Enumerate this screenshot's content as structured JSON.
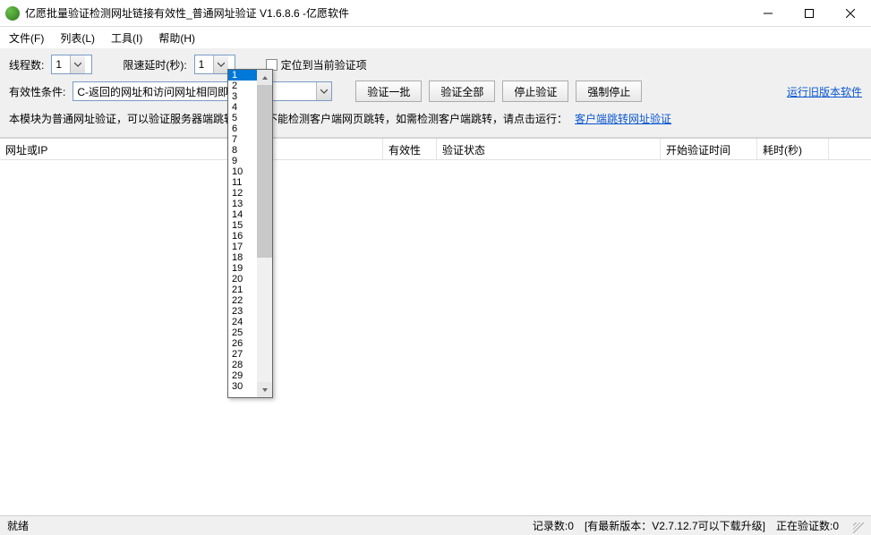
{
  "title": "亿愿批量验证检测网址链接有效性_普通网址验证 V1.6.8.6 -亿愿软件",
  "menu": {
    "file": "文件(F)",
    "list": "列表(L)",
    "tool": "工具(I)",
    "help": "帮助(H)"
  },
  "toolbar": {
    "threads_label": "线程数:",
    "threads_value": "1",
    "delay_label": "限速延时(秒):",
    "delay_value": "1",
    "locate_label": "定位到当前验证项",
    "condition_label": "有效性条件:",
    "condition_value": "C-返回的网址和访问网址相同即为有效",
    "btn_verify_one": "验证一批",
    "btn_verify_all": "验证全部",
    "btn_stop": "停止验证",
    "btn_force_stop": "强制停止",
    "link_old_version": "运行旧版本软件",
    "info_prefix": "本模块为普通网址验证，可以验证服务器端跳转，但是不能检测客户端网页跳转，如需检测客户端跳转，请点击运行：",
    "link_client_redirect": "客户端跳转网址验证"
  },
  "columns": {
    "url": "网址或IP",
    "valid": "有效性",
    "status": "验证状态",
    "start": "开始验证时间",
    "duration": "耗时(秒)"
  },
  "dropdown_items": [
    "1",
    "2",
    "3",
    "4",
    "5",
    "6",
    "7",
    "8",
    "9",
    "10",
    "11",
    "12",
    "13",
    "14",
    "15",
    "16",
    "17",
    "18",
    "19",
    "20",
    "21",
    "22",
    "23",
    "24",
    "25",
    "26",
    "27",
    "28",
    "29",
    "30"
  ],
  "dropdown_selected": "1",
  "status": {
    "ready": "就绪",
    "records": "记录数:0",
    "new_version": "[有最新版本：V2.7.12.7可以下载升级]",
    "verifying": "正在验证数:0"
  }
}
